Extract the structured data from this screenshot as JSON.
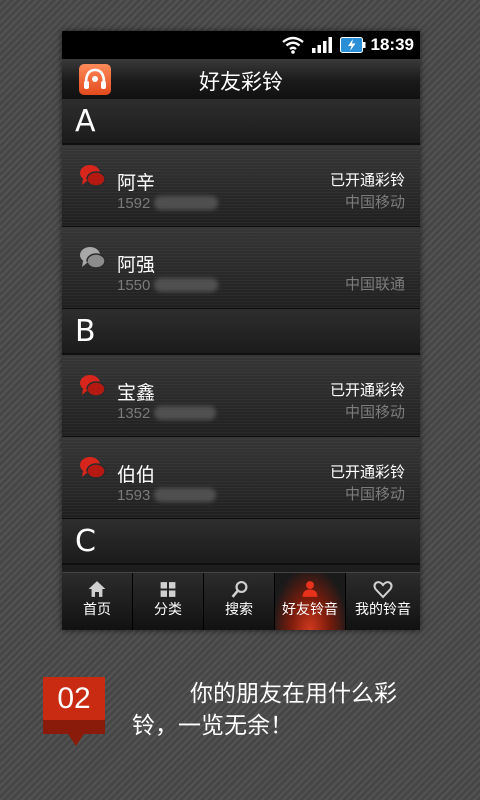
{
  "status_bar": {
    "time": "18:39"
  },
  "header": {
    "title": "好友彩铃"
  },
  "sections": [
    {
      "letter": "A",
      "contacts": [
        {
          "name": "阿辛",
          "phone": "1592",
          "status": "已开通彩铃",
          "carrier": "中国移动",
          "enabled": true
        },
        {
          "name": "阿强",
          "phone": "1550",
          "status": "",
          "carrier": "中国联通",
          "enabled": false
        }
      ]
    },
    {
      "letter": "B",
      "contacts": [
        {
          "name": "宝鑫",
          "phone": "1352",
          "status": "已开通彩铃",
          "carrier": "中国移动",
          "enabled": true
        },
        {
          "name": "伯伯",
          "phone": "1593",
          "status": "已开通彩铃",
          "carrier": "中国移动",
          "enabled": true
        }
      ]
    },
    {
      "letter": "C",
      "contacts": []
    }
  ],
  "nav": [
    {
      "label": "首页",
      "icon": "home-icon"
    },
    {
      "label": "分类",
      "icon": "grid-icon"
    },
    {
      "label": "搜索",
      "icon": "search-icon"
    },
    {
      "label": "好友铃音",
      "icon": "friend-icon",
      "active": true
    },
    {
      "label": "我的铃音",
      "icon": "heart-icon"
    }
  ],
  "promo": {
    "number": "02",
    "caption": "你的朋友在用什么彩铃，一览无余！"
  },
  "colors": {
    "accent": "#c92a12",
    "active_chat": "#d9261c",
    "inactive_chat": "#9a9a9a"
  }
}
